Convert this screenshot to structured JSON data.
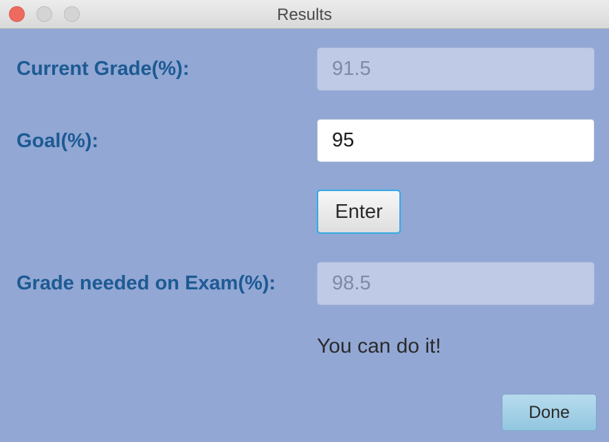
{
  "window": {
    "title": "Results"
  },
  "form": {
    "current_grade_label": "Current Grade(%):",
    "current_grade_value": "91.5",
    "goal_label": "Goal(%):",
    "goal_value": "95",
    "enter_label": "Enter",
    "exam_grade_label": "Grade needed on Exam(%):",
    "exam_grade_value": "98.5",
    "message": "You can do it!",
    "done_label": "Done"
  },
  "colors": {
    "background": "#92a7d4",
    "label_text": "#1d5a93",
    "focus_ring": "#3aa8e0",
    "close_button": "#ee6a5e"
  }
}
